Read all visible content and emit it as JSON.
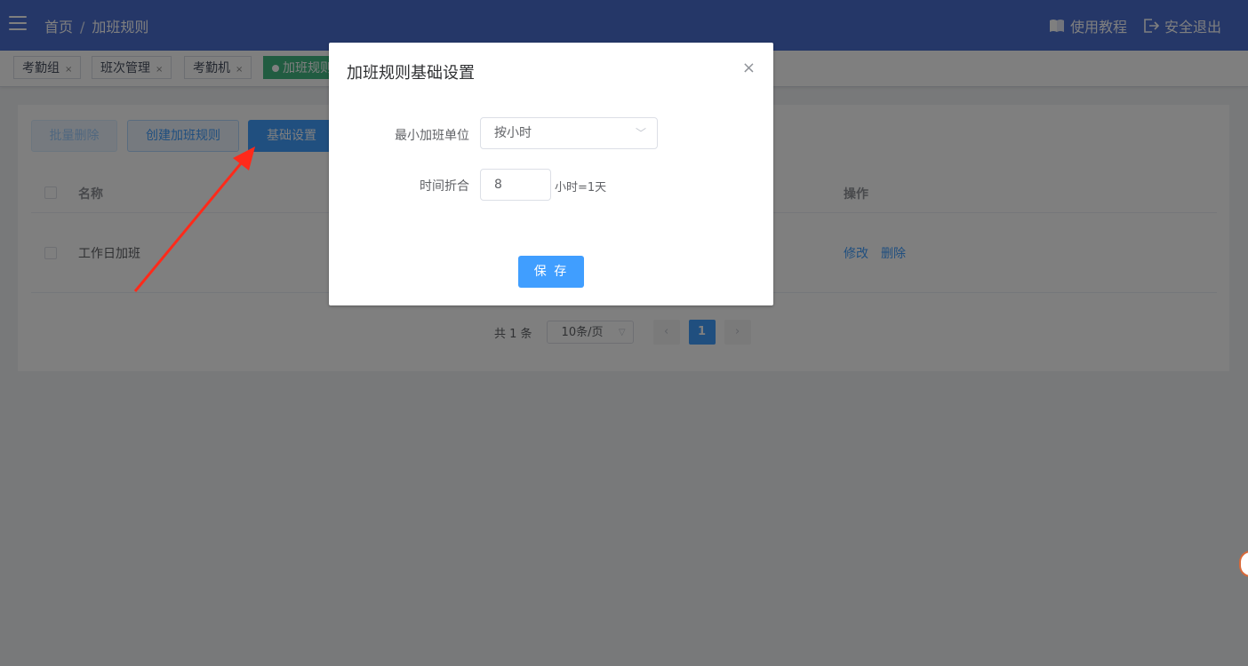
{
  "header": {
    "breadcrumb": [
      "首页",
      "加班规则"
    ],
    "breadcrumb_sep": "/",
    "tutorial_label": "使用教程",
    "logout_label": "安全退出"
  },
  "tabs": [
    {
      "label": "考勤组",
      "close": "×",
      "active": false
    },
    {
      "label": "班次管理",
      "close": "×",
      "active": false
    },
    {
      "label": "考勤机",
      "close": "×",
      "active": false
    },
    {
      "label": "加班规则",
      "close": "×",
      "active": true
    }
  ],
  "toolbar": {
    "batch_delete": "批量删除",
    "create_rule": "创建加班规则",
    "basic_settings": "基础设置"
  },
  "table": {
    "columns": {
      "name": "名称",
      "ops": "操作"
    },
    "rows": [
      {
        "name": "工作日加班",
        "edit": "修改",
        "delete": "删除"
      }
    ]
  },
  "pagination": {
    "total": "共 1 条",
    "page_size": "10条/页",
    "current_page": "1",
    "prev": "‹",
    "next": "›"
  },
  "dialog": {
    "title": "加班规则基础设置",
    "close": "×",
    "min_unit_label": "最小加班单位",
    "min_unit_value": "按小时",
    "convert_label": "时间折合",
    "convert_value": "8",
    "convert_unit": "小时=1天",
    "save": "保 存"
  },
  "colors": {
    "header": "#4a6fd0",
    "primary": "#409eff",
    "active_tab": "#42b983",
    "arrow": "#ff2a1a"
  }
}
